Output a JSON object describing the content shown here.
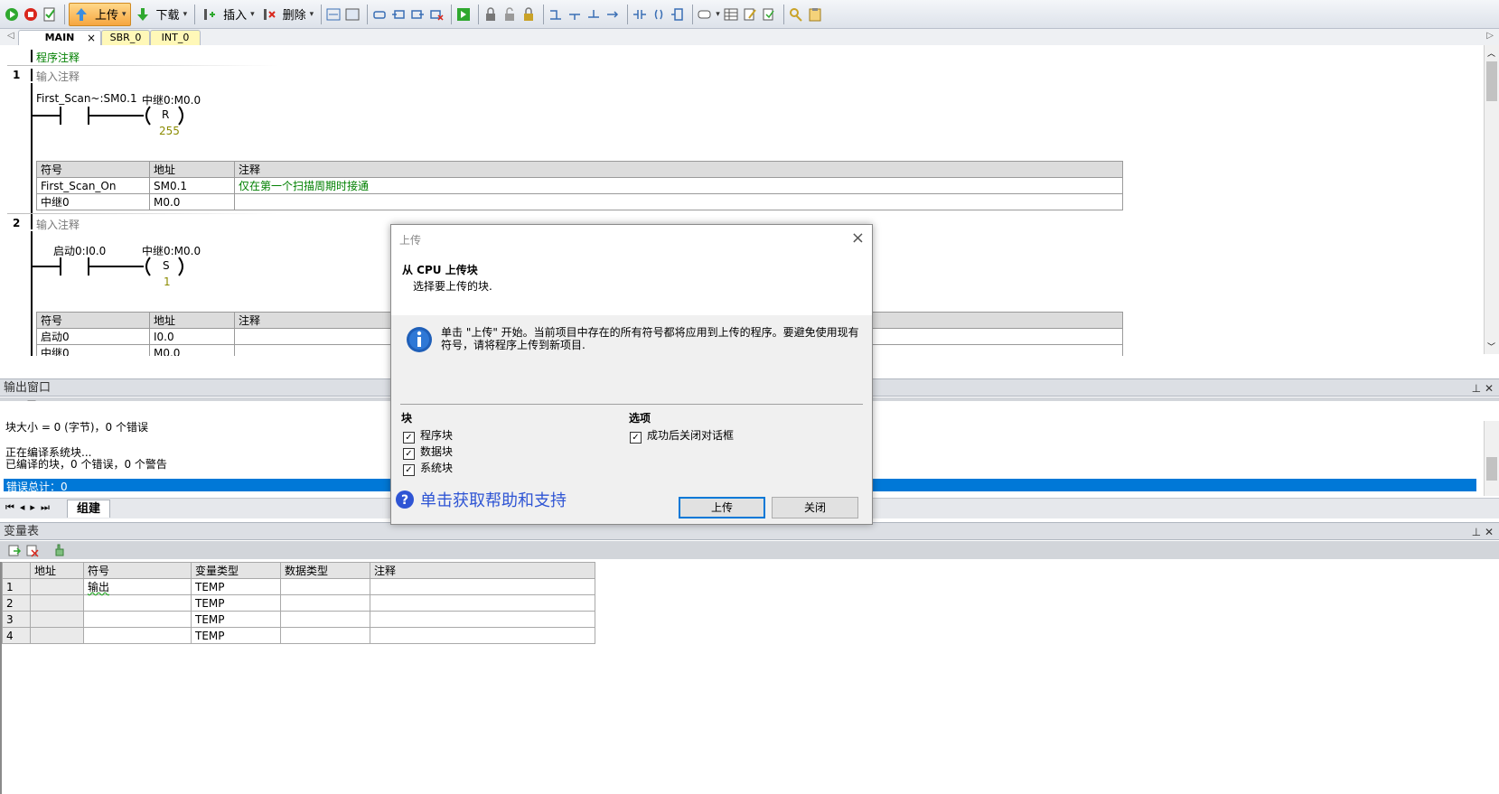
{
  "toolbar": {
    "upload": "上传",
    "download": "下载",
    "insert": "插入",
    "delete": "删除"
  },
  "tabs": [
    "MAIN",
    "SBR_0",
    "INT_0"
  ],
  "editor": {
    "program_comment": "程序注释",
    "networks": [
      {
        "number": "1",
        "comment": "输入注释",
        "contact_label": "First_Scan~:SM0.1",
        "coil_label": "中继0:M0.0",
        "coil_type": "R",
        "coil_n": "255",
        "sym_headers": [
          "符号",
          "地址",
          "注释"
        ],
        "sym_rows": [
          [
            "First_Scan_On",
            "SM0.1",
            "仅在第一个扫描周期时接通"
          ],
          [
            "中继0",
            "M0.0",
            ""
          ]
        ]
      },
      {
        "number": "2",
        "comment": "输入注释",
        "contact_label": "启动0:I0.0",
        "coil_label": "中继0:M0.0",
        "coil_type": "S",
        "coil_n": "1",
        "sym_headers": [
          "符号",
          "地址",
          "注释"
        ],
        "sym_rows": [
          [
            "启动0",
            "I0.0",
            ""
          ],
          [
            "中继0",
            "M0.0",
            ""
          ]
        ]
      }
    ]
  },
  "output": {
    "title": "输出窗口",
    "lines": [
      "块大小 = 0 (字节)，0 个错误",
      "",
      "正在编译系统块...",
      "已编译的块，0 个错误，0 个警告"
    ],
    "selected_line": "错误总计：0",
    "tab_label": "组建"
  },
  "vartable": {
    "title": "变量表",
    "headers": [
      "",
      "地址",
      "符号",
      "变量类型",
      "数据类型",
      "注释"
    ],
    "rows": [
      [
        "1",
        "",
        "输出",
        "TEMP",
        "",
        ""
      ],
      [
        "2",
        "",
        "",
        "TEMP",
        "",
        ""
      ],
      [
        "3",
        "",
        "",
        "TEMP",
        "",
        ""
      ],
      [
        "4",
        "",
        "",
        "TEMP",
        "",
        ""
      ]
    ]
  },
  "dialog": {
    "title": "上传",
    "heading": "从 CPU 上传块",
    "subheading": "选择要上传的块.",
    "info": "单击 \"上传\" 开始。当前项目中存在的所有符号都将应用到上传的程序。要避免使用现有符号，请将程序上传到新项目.",
    "blocks_label": "块",
    "options_label": "选项",
    "block_items": [
      "程序块",
      "数据块",
      "系统块"
    ],
    "option_items": [
      "成功后关闭对话框"
    ],
    "help_link": "单击获取帮助和支持",
    "upload_button": "上传",
    "close_button": "关闭"
  },
  "colors": {
    "accent": "#0078d7",
    "upload_button": "#f6a640",
    "green_text": "#008000",
    "help_link": "#2f55d4"
  }
}
